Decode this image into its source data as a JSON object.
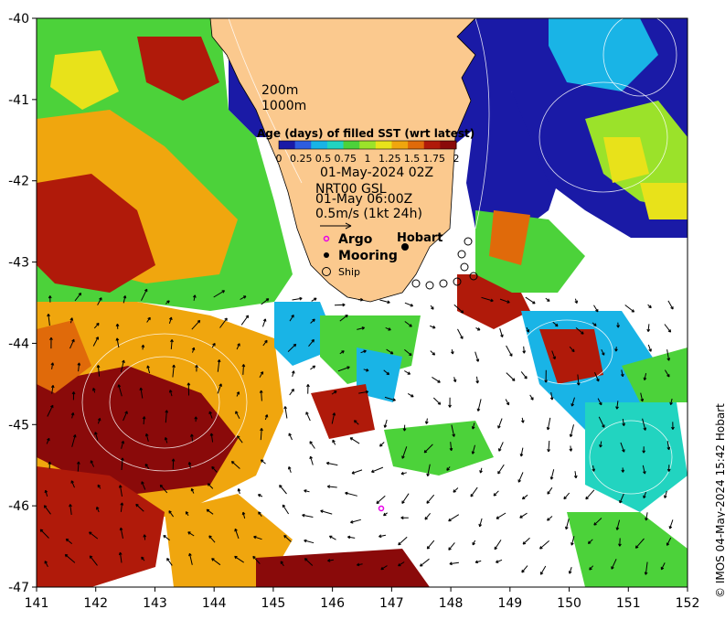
{
  "map": {
    "lon_range": [
      141,
      152
    ],
    "lat_range": [
      -47,
      -40
    ],
    "x_ticks": [
      "141",
      "142",
      "143",
      "144",
      "145",
      "146",
      "147",
      "148",
      "149",
      "150",
      "151",
      "152"
    ],
    "y_ticks": [
      "-40",
      "-41",
      "-42",
      "-43",
      "-44",
      "-45",
      "-46",
      "-47"
    ],
    "contour_labels": [
      "200m",
      "1000m"
    ],
    "colorbar": {
      "title": "Age (days) of filled SST (wrt latest)",
      "tick_labels": [
        "0",
        "0.25",
        "0.5",
        "0.75",
        "1",
        "1.25",
        "1.5",
        "1.75",
        "2"
      ],
      "colors": [
        "#1a1aa6",
        "#2d5de0",
        "#19b4e6",
        "#22d4c0",
        "#4cd23a",
        "#9be22a",
        "#e8e21a",
        "#f0a60e",
        "#e06a0a",
        "#b01a0a",
        "#8a0a0a"
      ]
    },
    "annotation": {
      "date": "01-May-2024 02Z",
      "product": "NRT00 GSL",
      "current_time": "01-May 06:00Z",
      "vector_scale": "0.5m/s (1kt 24h)"
    },
    "legend": {
      "argo": "Argo",
      "mooring": "Mooring",
      "ship": "Ship"
    },
    "place_label": "Hobart",
    "credit": "© IMOS 04-May-2024 15:42 Hobart",
    "colors": {
      "land": "#fbc98e",
      "no_data": "#ffffff",
      "argo_marker": "#e800e8"
    }
  }
}
